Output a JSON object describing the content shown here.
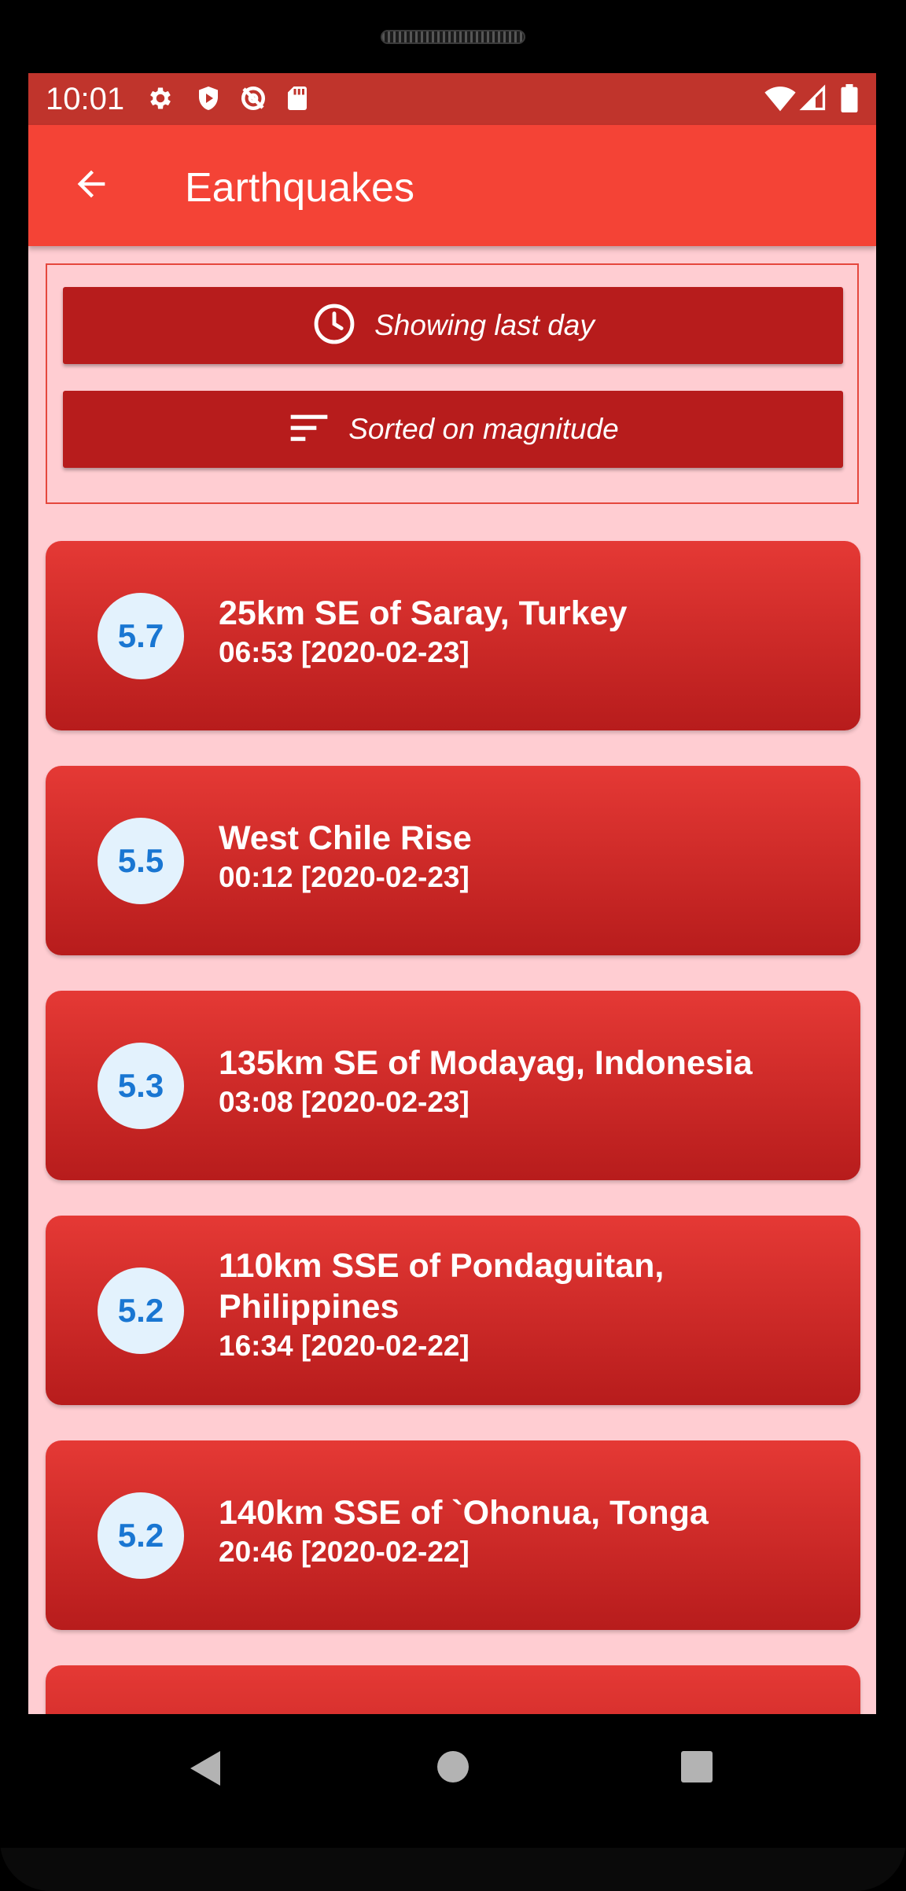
{
  "status_bar": {
    "time": "10:01",
    "left_icons": [
      "gear-icon",
      "shield-icon",
      "no-location-icon",
      "sd-card-icon"
    ],
    "right_icons": [
      "wifi-icon",
      "signal-icon",
      "battery-icon"
    ]
  },
  "app_bar": {
    "title": "Earthquakes",
    "back_icon": "arrow-left-icon"
  },
  "filters": {
    "time_filter_label": "Showing last day",
    "sort_label": "Sorted on magnitude"
  },
  "quakes": [
    {
      "magnitude": "5.7",
      "place": "25km SE of Saray, Turkey",
      "time": "06:53 [2020-02-23]"
    },
    {
      "magnitude": "5.5",
      "place": "West Chile Rise",
      "time": "00:12 [2020-02-23]"
    },
    {
      "magnitude": "5.3",
      "place": "135km SE of Modayag, Indonesia",
      "time": "03:08 [2020-02-23]"
    },
    {
      "magnitude": "5.2",
      "place": "110km SSE of Pondaguitan, Philippines",
      "time": "16:34 [2020-02-22]"
    },
    {
      "magnitude": "5.2",
      "place": "140km SSE of `Ohonua, Tonga",
      "time": "20:46 [2020-02-22]"
    }
  ],
  "colors": {
    "status_bar": "#c0342c",
    "app_bar": "#f44336",
    "background": "#ffcdd2",
    "filter_button": "#b71c1c",
    "card_top": "#e53935",
    "card_bottom": "#b71c1c",
    "magnitude_circle": "#e3f2fd",
    "magnitude_text": "#1976d2"
  },
  "nav_bar": {
    "icons": [
      "back-triangle-icon",
      "home-circle-icon",
      "recents-square-icon"
    ]
  }
}
